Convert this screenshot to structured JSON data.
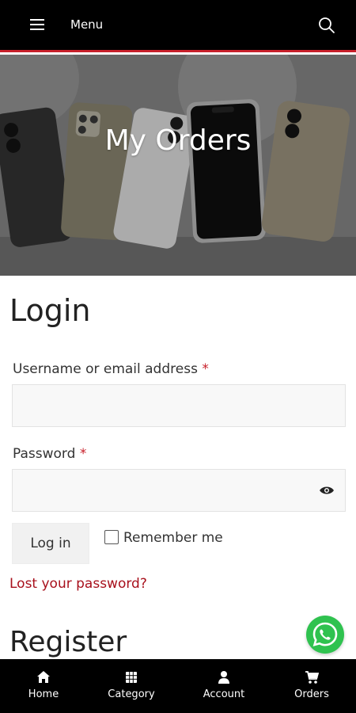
{
  "topbar": {
    "menu_label": "Menu",
    "accent": "#c8202a"
  },
  "hero": {
    "title": "My Orders"
  },
  "login": {
    "title": "Login",
    "username_label": "Username or email address",
    "password_label": "Password",
    "required_mark": "*",
    "username_value": "",
    "password_value": "",
    "login_button": "Log in",
    "remember_me": "Remember me",
    "lost_password": "Lost your password?"
  },
  "register": {
    "title": "Register"
  },
  "bottom_nav": {
    "items": [
      {
        "label": "Home",
        "icon": "home-icon"
      },
      {
        "label": "Category",
        "icon": "grid-icon"
      },
      {
        "label": "Account",
        "icon": "user-icon"
      },
      {
        "label": "Orders",
        "icon": "cart-icon"
      }
    ]
  }
}
